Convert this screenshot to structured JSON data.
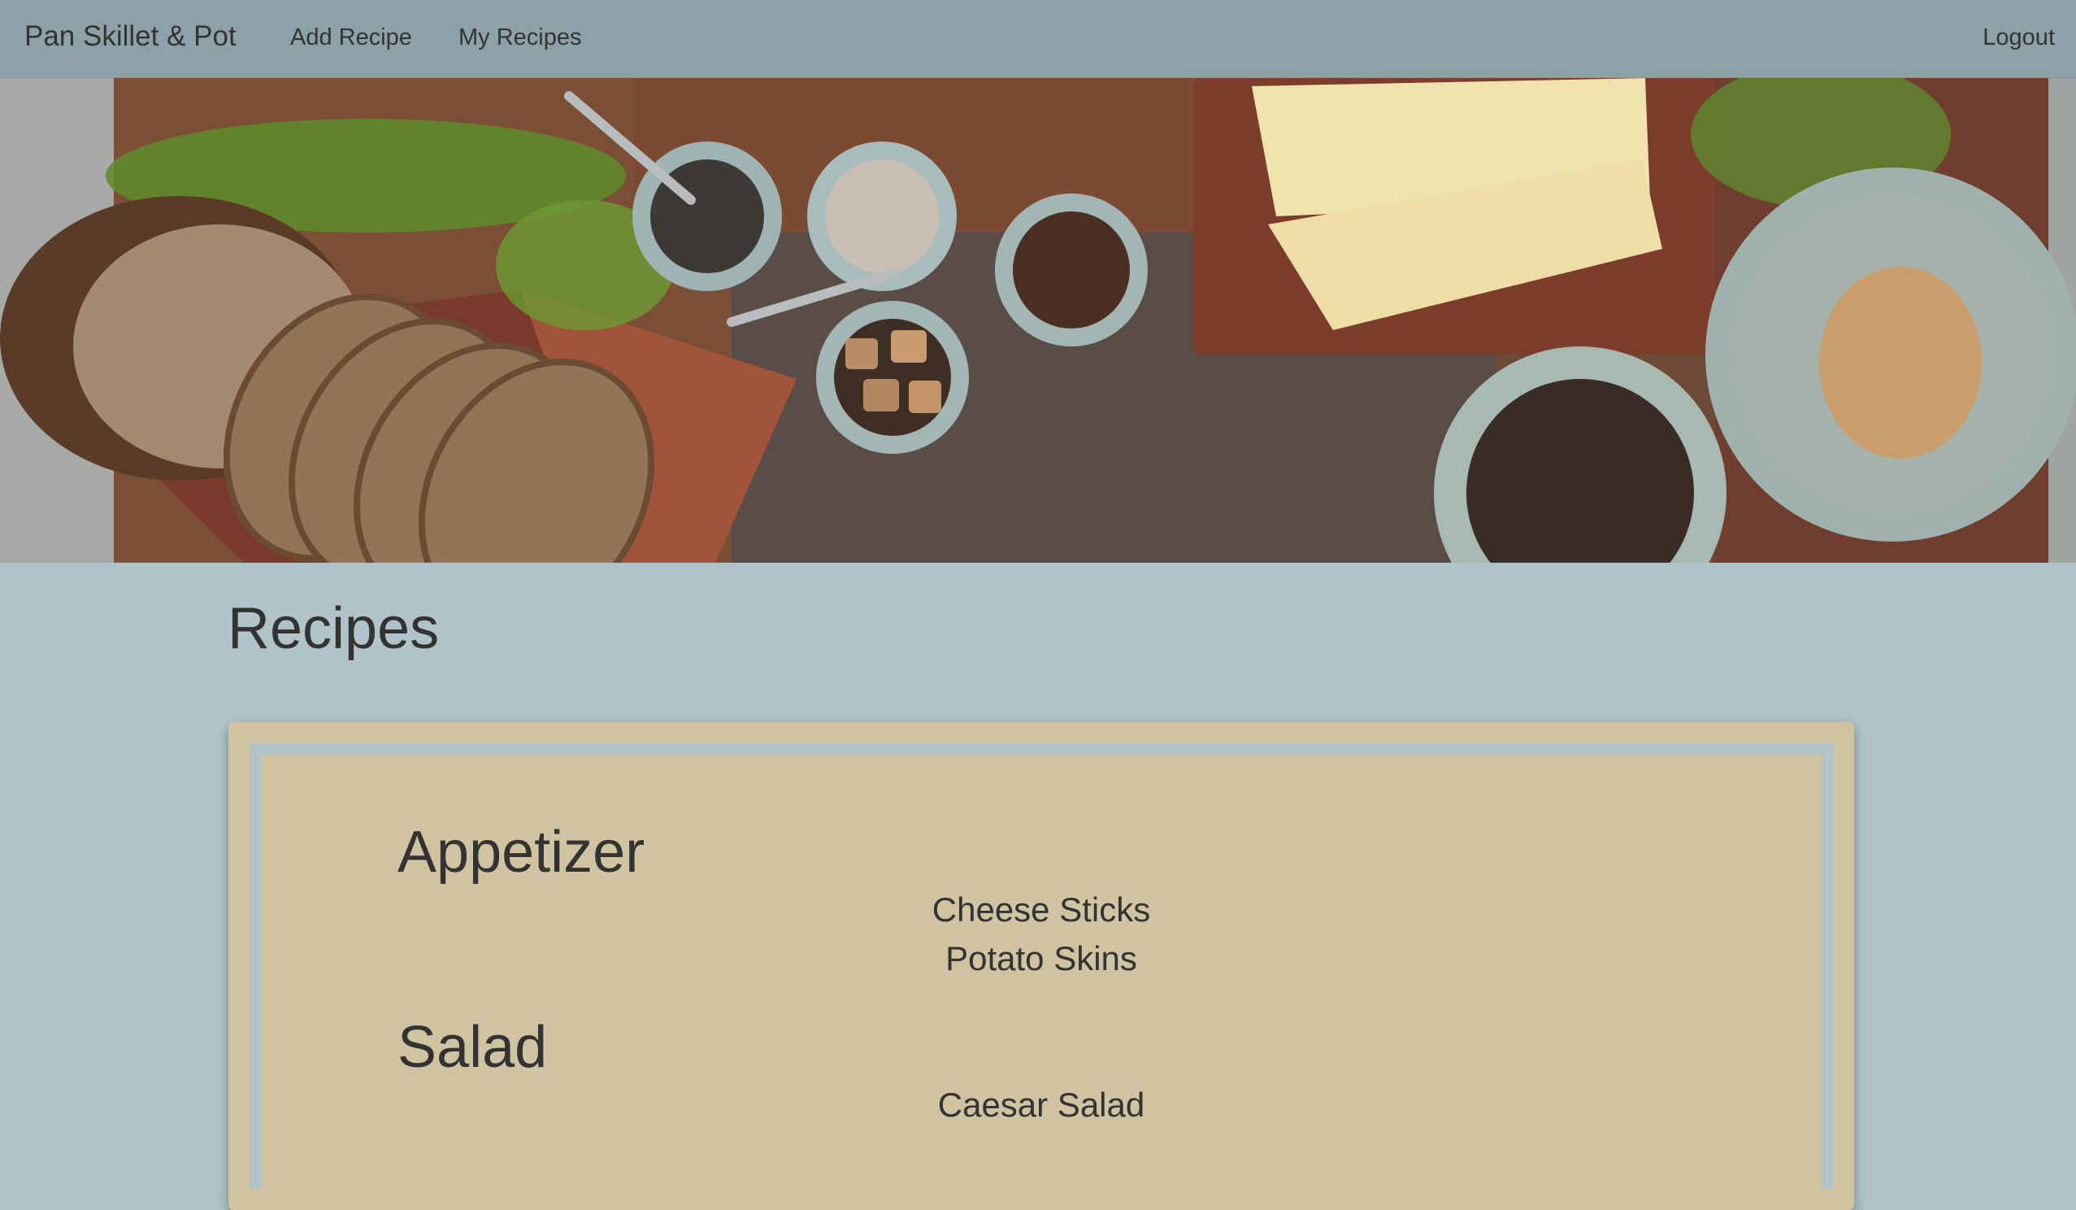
{
  "navbar": {
    "brand": "Pan Skillet & Pot",
    "links": [
      {
        "label": "Add Recipe"
      },
      {
        "label": "My Recipes"
      }
    ],
    "logout": "Logout",
    "background": "#8da2a8"
  },
  "hero": {
    "description": "food-photo-banner"
  },
  "page": {
    "title": "Recipes",
    "background": "#b0c3c8"
  },
  "recipes": {
    "card_color": "#d0c3a2",
    "categories": [
      {
        "name": "Appetizer",
        "items": [
          "Cheese Sticks",
          "Potato Skins"
        ]
      },
      {
        "name": "Salad",
        "items": [
          "Caesar Salad"
        ]
      }
    ]
  }
}
